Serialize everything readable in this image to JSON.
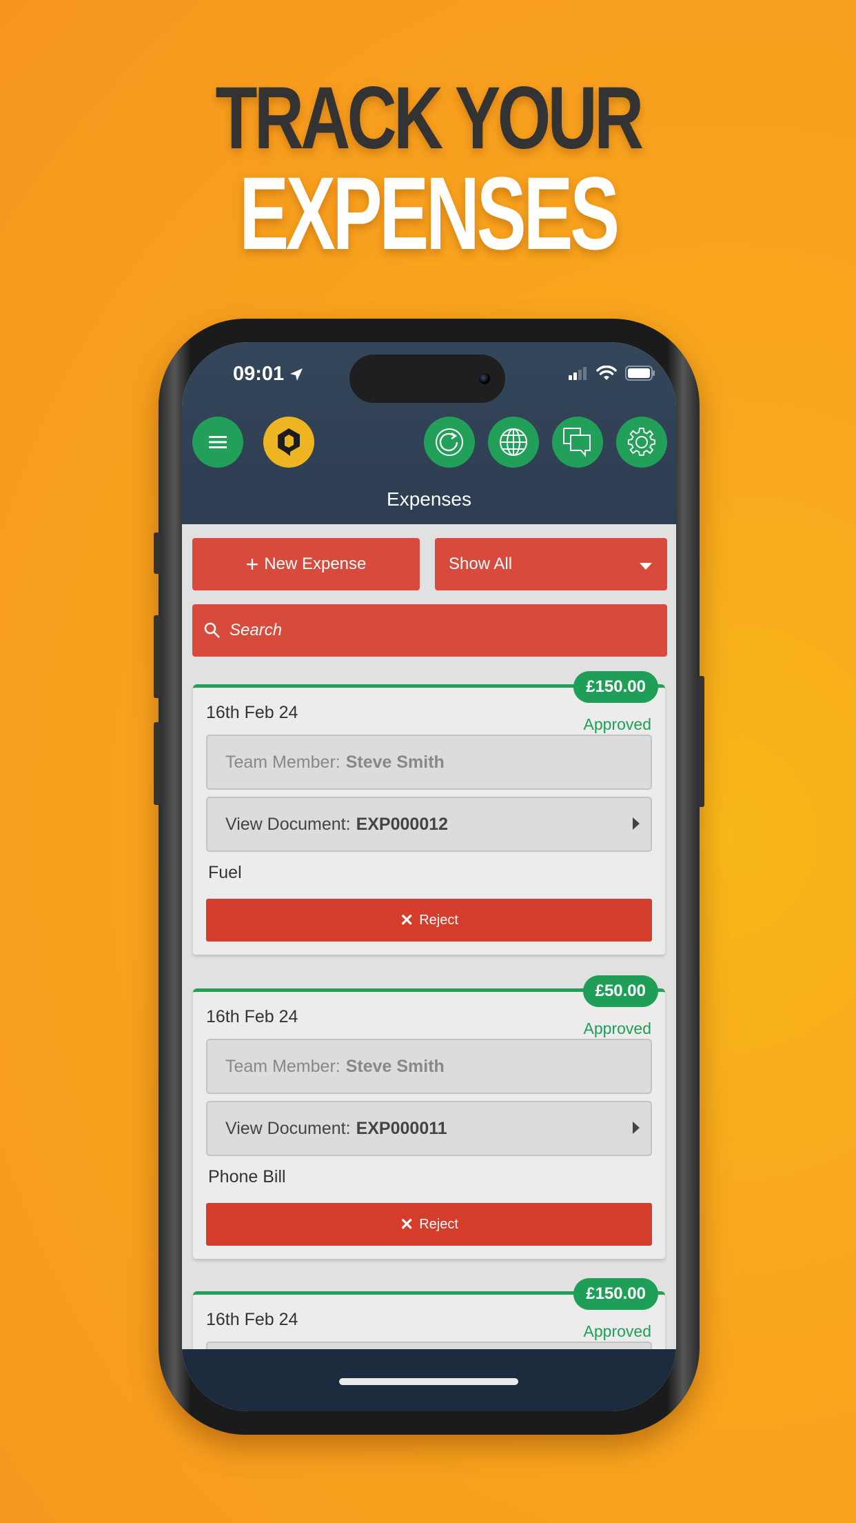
{
  "headline": {
    "line1": "TRACK YOUR",
    "line2": "EXPENSES"
  },
  "status_bar": {
    "time": "09:01"
  },
  "header": {
    "title": "Expenses",
    "buttons": [
      {
        "name": "menu",
        "icon": "hamburger-icon"
      },
      {
        "name": "logo",
        "icon": "app-logo-icon"
      },
      {
        "name": "refresh",
        "icon": "refresh-icon"
      },
      {
        "name": "language",
        "icon": "globe-icon"
      },
      {
        "name": "messages",
        "icon": "chat-icon"
      },
      {
        "name": "settings",
        "icon": "gear-icon"
      }
    ]
  },
  "actions": {
    "new_expense_label": "New Expense",
    "filter": {
      "selected": "Show All"
    },
    "search": {
      "placeholder": "Search",
      "value": ""
    }
  },
  "expenses": [
    {
      "amount": "£150.00",
      "date": "16th Feb 24",
      "status": "Approved",
      "team_member_label": "Team Member:",
      "team_member": "Steve Smith",
      "document_label": "View Document:",
      "document": "EXP000012",
      "category": "Fuel",
      "reject_label": "Reject"
    },
    {
      "amount": "£50.00",
      "date": "16th Feb 24",
      "status": "Approved",
      "team_member_label": "Team Member:",
      "team_member": "Steve Smith",
      "document_label": "View Document:",
      "document": "EXP000011",
      "category": "Phone Bill",
      "reject_label": "Reject"
    },
    {
      "amount": "£150.00",
      "date": "16th Feb 24",
      "status": "Approved"
    }
  ],
  "colors": {
    "background": "#f8a61d",
    "header": "#2e3e52",
    "accent_green": "#22a05a",
    "accent_red": "#d84a3c",
    "logo_yellow": "#eeb421"
  }
}
